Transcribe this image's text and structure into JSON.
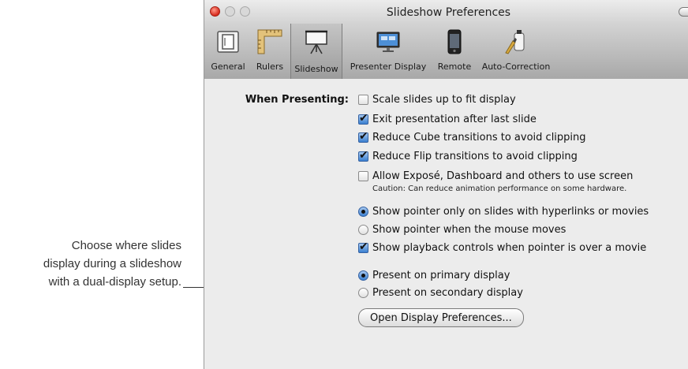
{
  "callout": {
    "line1": "Choose where slides",
    "line2": "display during a slideshow",
    "line3": "with a dual-display setup."
  },
  "window": {
    "title": "Slideshow Preferences"
  },
  "toolbar": {
    "items": [
      {
        "label": "General",
        "icon": "general-icon"
      },
      {
        "label": "Rulers",
        "icon": "rulers-icon"
      },
      {
        "label": "Slideshow",
        "icon": "slideshow-icon",
        "selected": true
      },
      {
        "label": "Presenter Display",
        "icon": "presenter-display-icon"
      },
      {
        "label": "Remote",
        "icon": "remote-icon"
      },
      {
        "label": "Auto-Correction",
        "icon": "auto-correction-icon"
      }
    ]
  },
  "content": {
    "section_label": "When Presenting:",
    "options": [
      {
        "label": "Scale slides up to fit display",
        "type": "checkbox",
        "checked": false
      },
      {
        "label": "Exit presentation after last slide",
        "type": "checkbox",
        "checked": true
      },
      {
        "label": "Reduce Cube transitions to avoid clipping",
        "type": "checkbox",
        "checked": true
      },
      {
        "label": "Reduce Flip transitions to avoid clipping",
        "type": "checkbox",
        "checked": true
      },
      {
        "label": "Allow Exposé, Dashboard and others to use screen",
        "type": "checkbox",
        "checked": false
      },
      {
        "label": "Show pointer only on slides with hyperlinks or movies",
        "type": "radio",
        "checked": true
      },
      {
        "label": "Show pointer when the mouse moves",
        "type": "radio",
        "checked": false
      },
      {
        "label": "Show playback controls when pointer is over a movie",
        "type": "checkbox",
        "checked": true
      },
      {
        "label": "Present on primary display",
        "type": "radio",
        "checked": true
      },
      {
        "label": "Present on secondary display",
        "type": "radio",
        "checked": false
      }
    ],
    "caution": "Caution: Can reduce animation performance on some hardware.",
    "open_display_button": "Open Display Preferences..."
  },
  "colors": {
    "accent": "#3a7fd0",
    "close_button": "#d7291c"
  }
}
